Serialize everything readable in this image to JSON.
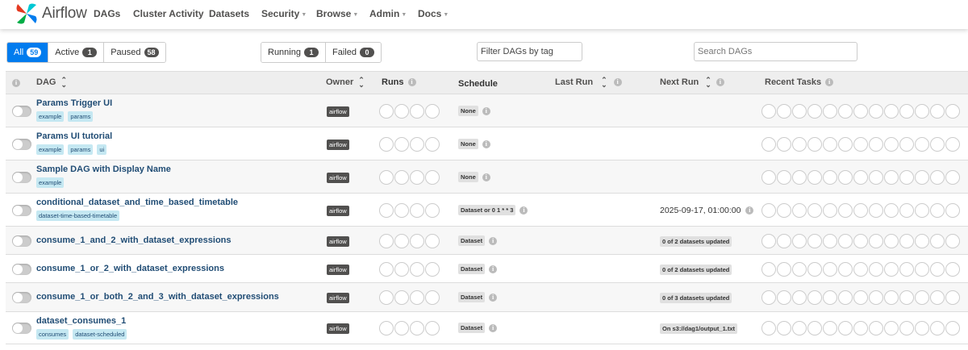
{
  "app": {
    "name": "Airflow"
  },
  "nav": {
    "items": [
      {
        "label": "DAGs",
        "dropdown": false
      },
      {
        "label": "Cluster Activity",
        "dropdown": false
      },
      {
        "label": "Datasets",
        "dropdown": false
      },
      {
        "label": "Security",
        "dropdown": true
      },
      {
        "label": "Browse",
        "dropdown": true
      },
      {
        "label": "Admin",
        "dropdown": true
      },
      {
        "label": "Docs",
        "dropdown": true
      }
    ]
  },
  "filters": {
    "status": [
      {
        "label": "All",
        "count": "59",
        "active": true
      },
      {
        "label": "Active",
        "count": "1",
        "active": false
      },
      {
        "label": "Paused",
        "count": "58",
        "active": false
      }
    ],
    "run_state": [
      {
        "label": "Running",
        "count": "1"
      },
      {
        "label": "Failed",
        "count": "0"
      }
    ],
    "tag_placeholder": "Filter DAGs by tag",
    "search_placeholder": "Search DAGs"
  },
  "table": {
    "headers": {
      "dag": "DAG",
      "owner": "Owner",
      "runs": "Runs",
      "schedule": "Schedule",
      "last_run": "Last Run",
      "next_run": "Next Run",
      "recent_tasks": "Recent Tasks"
    },
    "rows": [
      {
        "name": "Params Trigger UI",
        "tags": [
          "example",
          "params"
        ],
        "owner": "airflow",
        "schedule": "None",
        "next_run": "",
        "next_run_badge": ""
      },
      {
        "name": "Params UI tutorial",
        "tags": [
          "example",
          "params",
          "ui"
        ],
        "owner": "airflow",
        "schedule": "None",
        "next_run": "",
        "next_run_badge": ""
      },
      {
        "name": "Sample DAG with Display Name",
        "tags": [
          "example"
        ],
        "owner": "airflow",
        "schedule": "None",
        "next_run": "",
        "next_run_badge": ""
      },
      {
        "name": "conditional_dataset_and_time_based_timetable",
        "tags": [
          "dataset-time-based-timetable"
        ],
        "owner": "airflow",
        "schedule": "Dataset or 0 1 * * 3",
        "next_run": "2025-09-17, 01:00:00",
        "next_run_badge": ""
      },
      {
        "name": "consume_1_and_2_with_dataset_expressions",
        "tags": [],
        "owner": "airflow",
        "schedule": "Dataset",
        "next_run": "",
        "next_run_badge": "0 of 2 datasets updated"
      },
      {
        "name": "consume_1_or_2_with_dataset_expressions",
        "tags": [],
        "owner": "airflow",
        "schedule": "Dataset",
        "next_run": "",
        "next_run_badge": "0 of 2 datasets updated"
      },
      {
        "name": "consume_1_or_both_2_and_3_with_dataset_expressions",
        "tags": [],
        "owner": "airflow",
        "schedule": "Dataset",
        "next_run": "",
        "next_run_badge": "0 of 3 datasets updated"
      },
      {
        "name": "dataset_consumes_1",
        "tags": [
          "consumes",
          "dataset-scheduled"
        ],
        "owner": "airflow",
        "schedule": "Dataset",
        "next_run": "",
        "next_run_badge": "On s3://dag1/output_1.txt"
      }
    ]
  },
  "colors": {
    "accent": "#017cee",
    "link": "#214d75",
    "tag_bg": "#c5e8f2",
    "badge_dark": "#51504f",
    "logo_colors": [
      "#e43921",
      "#00c7d4",
      "#017cee",
      "#00ad46"
    ]
  },
  "icons": {
    "logo": "airflow-pinwheel-icon",
    "info": "info-circle-icon",
    "sort": "sort-arrows-icon",
    "caret": "caret-down-icon"
  }
}
